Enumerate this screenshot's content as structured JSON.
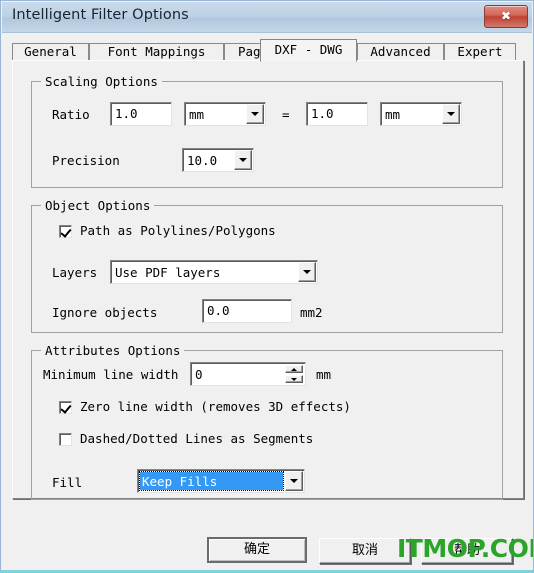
{
  "window": {
    "title": "Intelligent Filter Options",
    "close_icon": "close-x-icon",
    "close_label": "✖"
  },
  "tabs": [
    {
      "label": "General",
      "selected": false
    },
    {
      "label": "Font Mappings",
      "selected": false
    },
    {
      "label": "Page",
      "selected": false
    },
    {
      "label": "DXF - DWG",
      "selected": true
    },
    {
      "label": "Advanced",
      "selected": false
    },
    {
      "label": "Expert",
      "selected": false
    }
  ],
  "scaling_options": {
    "legend": "Scaling Options",
    "ratio_label": "Ratio",
    "ratio_from_value": "1.0",
    "ratio_from_unit": "mm",
    "equals_label": "=",
    "ratio_to_value": "1.0",
    "ratio_to_unit": "mm",
    "precision_label": "Precision",
    "precision_value": "10.0"
  },
  "object_options": {
    "legend": "Object Options",
    "path_as_polylines_label": "Path as Polylines/Polygons",
    "path_as_polylines_checked": true,
    "layers_label": "Layers",
    "layers_value": "Use PDF layers",
    "ignore_objects_label": "Ignore objects",
    "ignore_objects_value": "0.0",
    "ignore_objects_unit": "mm2"
  },
  "attributes_options": {
    "legend": "Attributes Options",
    "minimum_line_width_label": "Minimum line width",
    "minimum_line_width_value": "0",
    "minimum_line_width_unit": "mm",
    "zero_line_width_label": "Zero line width (removes 3D effects)",
    "zero_line_width_checked": true,
    "dashed_dotted_label": "Dashed/Dotted Lines as Segments",
    "dashed_dotted_checked": false,
    "fill_label": "Fill",
    "fill_value": "Keep Fills"
  },
  "buttons": {
    "ok": "确定",
    "cancel": "取消",
    "help": "帮助"
  },
  "watermark": {
    "text": "ITMOP.COM",
    "color": "#2aa52a"
  },
  "colors": {
    "titlebar": "#bed2e6",
    "dialog_face": "#f0f0f0",
    "selection_blue": "#3399f4",
    "close_red": "#bf4232",
    "bottom_edge": "#7fd2e0"
  }
}
